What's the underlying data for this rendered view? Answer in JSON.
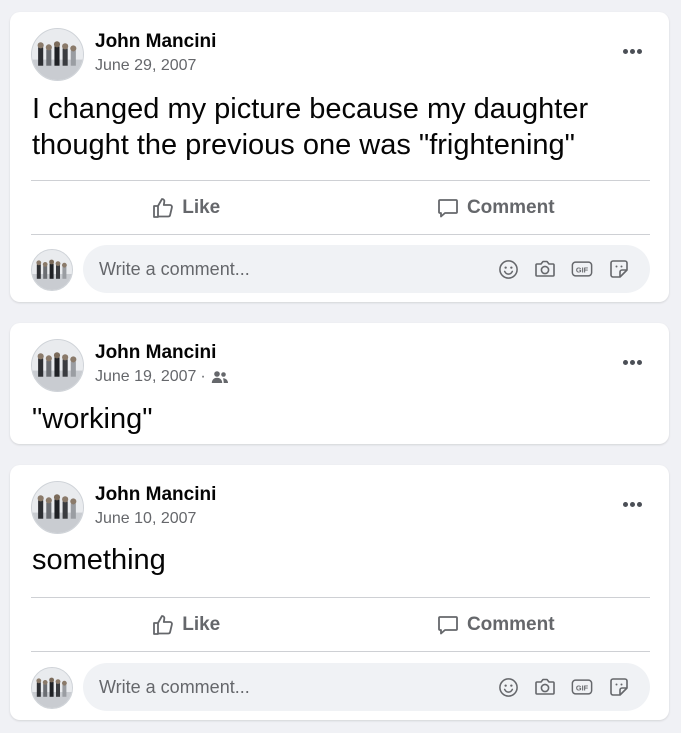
{
  "posts": [
    {
      "author": "John Mancini",
      "date": "June 29, 2007",
      "text": "I changed my picture because my daughter thought the previous one was \"frightening\"",
      "like_label": "Like",
      "comment_label": "Comment",
      "comment_placeholder": "Write a comment..."
    },
    {
      "author": "John Mancini",
      "date": "June 19, 2007",
      "separator": "·",
      "audience_icon": "friends-icon",
      "text": "\"working\""
    },
    {
      "author": "John Mancini",
      "date": "June 10, 2007",
      "text": "something",
      "like_label": "Like",
      "comment_label": "Comment",
      "comment_placeholder": "Write a comment..."
    }
  ],
  "comment_tools": {
    "gif_label": "GIF",
    "icons": [
      "emoji-icon",
      "camera-icon",
      "gif-icon",
      "sticker-icon"
    ]
  },
  "colors": {
    "background": "#f0f1f5",
    "card": "#ffffff",
    "primary_text": "#050505",
    "secondary_text": "#65676b",
    "divider": "#ced0d4",
    "input_background": "#f0f2f5"
  }
}
